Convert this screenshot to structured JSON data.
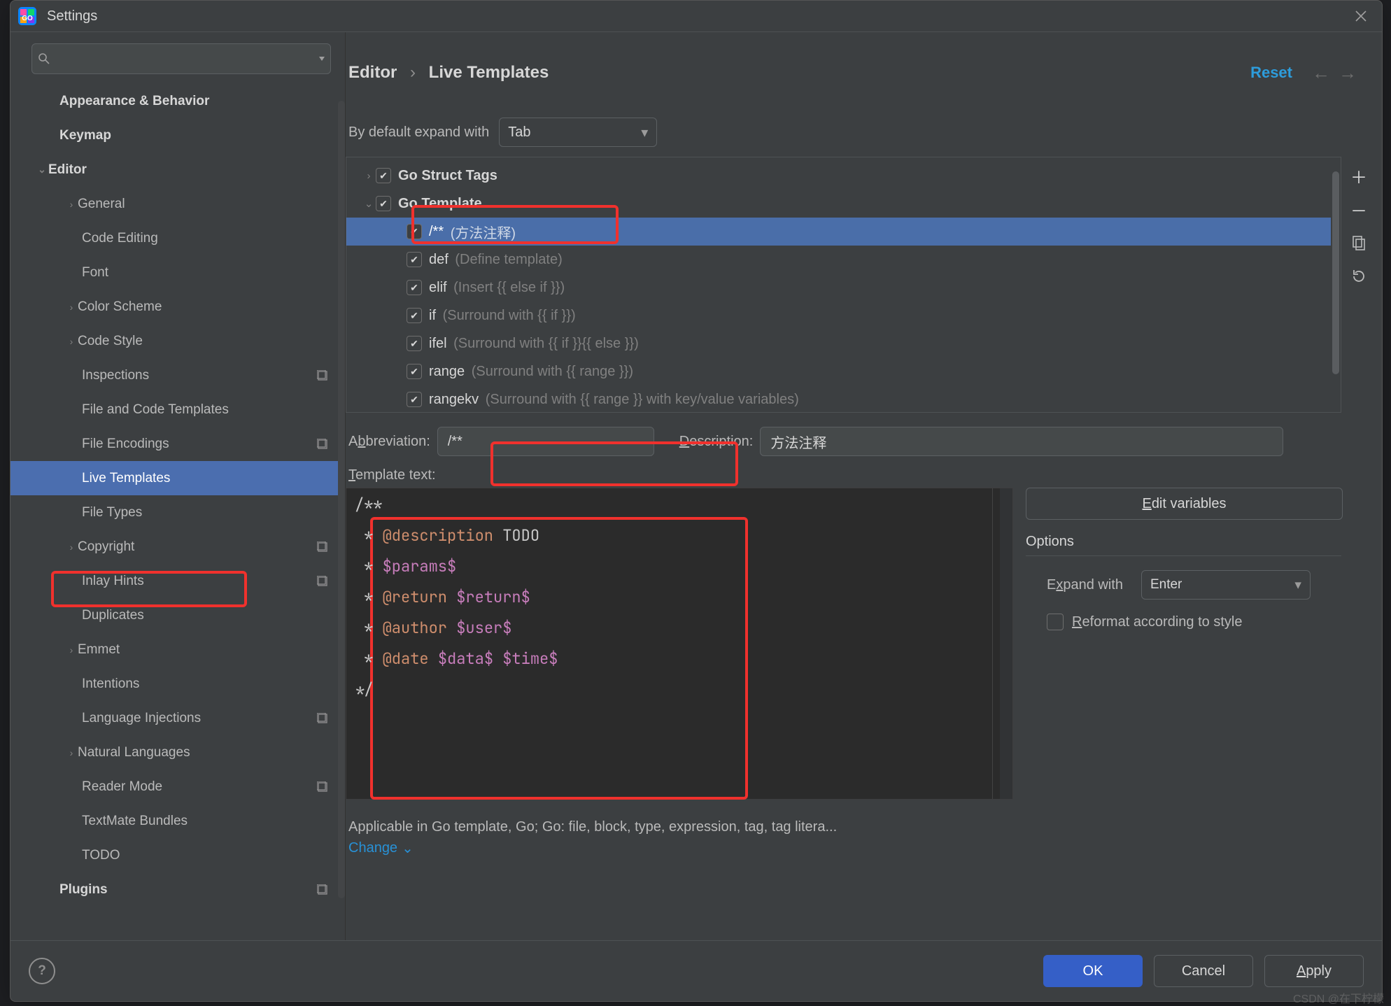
{
  "window": {
    "title": "Settings"
  },
  "search": {
    "placeholder": ""
  },
  "breadcrumb": {
    "parent": "Editor",
    "current": "Live Templates"
  },
  "reset_label": "Reset",
  "sidebar": {
    "items": [
      {
        "label": "Appearance & Behavior",
        "bold": true,
        "lvl": "lvl0"
      },
      {
        "label": "Keymap",
        "bold": true,
        "lvl": "lvl0"
      },
      {
        "label": "Editor",
        "bold": true,
        "lvl": "lvl0-exp",
        "expanded": true
      },
      {
        "label": "General",
        "lvl": "lvl1-exp",
        "arrow": true
      },
      {
        "label": "Code Editing",
        "lvl": "lvl1"
      },
      {
        "label": "Font",
        "lvl": "lvl1"
      },
      {
        "label": "Color Scheme",
        "lvl": "lvl1-exp",
        "arrow": true
      },
      {
        "label": "Code Style",
        "lvl": "lvl1-exp",
        "arrow": true
      },
      {
        "label": "Inspections",
        "lvl": "lvl1",
        "cfg": true
      },
      {
        "label": "File and Code Templates",
        "lvl": "lvl1"
      },
      {
        "label": "File Encodings",
        "lvl": "lvl1",
        "cfg": true
      },
      {
        "label": "Live Templates",
        "lvl": "lvl1",
        "selected": true
      },
      {
        "label": "File Types",
        "lvl": "lvl1"
      },
      {
        "label": "Copyright",
        "lvl": "lvl1-exp",
        "arrow": true,
        "cfg": true
      },
      {
        "label": "Inlay Hints",
        "lvl": "lvl1",
        "cfg": true
      },
      {
        "label": "Duplicates",
        "lvl": "lvl1"
      },
      {
        "label": "Emmet",
        "lvl": "lvl1-exp",
        "arrow": true
      },
      {
        "label": "Intentions",
        "lvl": "lvl1"
      },
      {
        "label": "Language Injections",
        "lvl": "lvl1",
        "cfg": true
      },
      {
        "label": "Natural Languages",
        "lvl": "lvl1-exp",
        "arrow": true
      },
      {
        "label": "Reader Mode",
        "lvl": "lvl1",
        "cfg": true
      },
      {
        "label": "TextMate Bundles",
        "lvl": "lvl1"
      },
      {
        "label": "TODO",
        "lvl": "lvl1"
      },
      {
        "label": "Plugins",
        "bold": true,
        "lvl": "lvl0",
        "cfg": true
      }
    ]
  },
  "main": {
    "expand_label": "By default expand with",
    "expand_value": "Tab",
    "groups": [
      {
        "kind": "group",
        "name": "Go Struct Tags",
        "expanded": false,
        "checked": true,
        "bold": true
      },
      {
        "kind": "group",
        "name": "Go Template",
        "expanded": true,
        "checked": true,
        "bold": true
      },
      {
        "kind": "item",
        "name": "/** ",
        "desc": "(方法注释)",
        "selected": true,
        "checked": true
      },
      {
        "kind": "item",
        "name": "def ",
        "desc": "(Define template)",
        "checked": true
      },
      {
        "kind": "item",
        "name": "elif ",
        "desc": "(Insert {{ else if }})",
        "checked": true
      },
      {
        "kind": "item",
        "name": "if ",
        "desc": "(Surround with {{ if }})",
        "checked": true
      },
      {
        "kind": "item",
        "name": "ifel ",
        "desc": "(Surround with {{ if }}{{ else }})",
        "checked": true
      },
      {
        "kind": "item",
        "name": "range ",
        "desc": "(Surround with {{ range }})",
        "checked": true
      },
      {
        "kind": "item",
        "name": "rangekv ",
        "desc": "(Surround with {{ range }} with key/value variables)",
        "checked": true
      }
    ],
    "form": {
      "abbreviation_label_pre": "A",
      "abbreviation_label_ul": "b",
      "abbreviation_label_post": "breviation:",
      "abbreviation_value": "/**",
      "description_label_pre": "",
      "description_label_ul": "D",
      "description_label_post": "escription:",
      "description_value": "方法注释",
      "template_text_label": "Template text:"
    },
    "code_tokens": [
      {
        "t": "/**",
        "cls": ""
      },
      {
        "br": true
      },
      {
        "t": " * ",
        "cls": ""
      },
      {
        "t": "@description",
        "cls": "kw"
      },
      {
        "t": " TODO",
        "cls": ""
      },
      {
        "br": true
      },
      {
        "t": " * ",
        "cls": ""
      },
      {
        "t": "$params$",
        "cls": "param"
      },
      {
        "br": true
      },
      {
        "t": " * ",
        "cls": ""
      },
      {
        "t": "@return",
        "cls": "kw"
      },
      {
        "t": " ",
        "cls": ""
      },
      {
        "t": "$return$",
        "cls": "param"
      },
      {
        "br": true
      },
      {
        "t": " * ",
        "cls": ""
      },
      {
        "t": "@author",
        "cls": "kw"
      },
      {
        "t": " ",
        "cls": ""
      },
      {
        "t": "$user$",
        "cls": "param"
      },
      {
        "br": true
      },
      {
        "t": " * ",
        "cls": ""
      },
      {
        "t": "@date",
        "cls": "kw"
      },
      {
        "t": " ",
        "cls": ""
      },
      {
        "t": "$data$",
        "cls": "param"
      },
      {
        "t": " ",
        "cls": ""
      },
      {
        "t": "$time$",
        "cls": "param"
      },
      {
        "br": true
      },
      {
        "t": "*/",
        "cls": ""
      }
    ],
    "edit_variables_label": "Edit variables",
    "options_title": "Options",
    "options": {
      "expand_with_label": "Expand with",
      "expand_with_value": "Enter",
      "reformat_label": "Reformat according to style",
      "reformat_checked": false
    },
    "applicable_text": "Applicable in Go template, Go; Go: file, block, type, expression, tag, tag litera...",
    "change_label": "Change"
  },
  "footer": {
    "ok": "OK",
    "cancel": "Cancel",
    "apply": "Apply"
  },
  "watermark": "CSDN @在下柠檬"
}
